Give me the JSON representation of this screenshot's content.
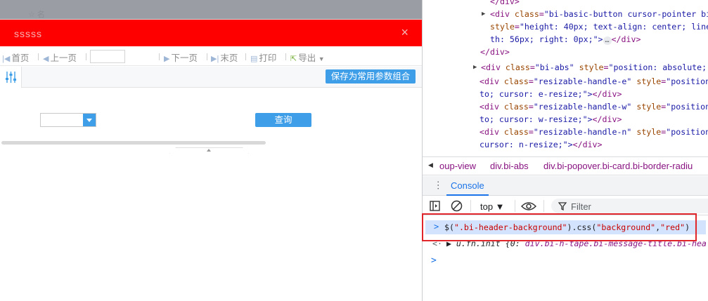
{
  "app": {
    "ghost_text": "☆ 名",
    "dialog": {
      "title": "sssss",
      "close_icon": "×"
    },
    "toolbar": {
      "first": "首页",
      "prev": "上一页",
      "page_value": "",
      "next": "下一页",
      "last": "末页",
      "print": "打印",
      "export": "导出"
    },
    "param": {
      "save_label": "保存为常用参数组合"
    },
    "form": {
      "combo_value": "",
      "query_label": "查询"
    }
  },
  "devtools": {
    "elements": [
      {
        "text": "</div>"
      },
      {
        "open": "<div",
        "attr": "class",
        "val": "\"bi-basic-button cursor-pointer bi",
        "rest": ""
      },
      {
        "attr": "style",
        "val": "\"height: 40px; text-align: center; line"
      },
      {
        "cont": "th: 56px; right: 0px;\">",
        "ellipsis": "…",
        "close": "</div>"
      },
      {
        "text": "</div>"
      },
      {
        "open": "<div",
        "attr": "class",
        "val": "\"bi-abs\"",
        "attr2": "style",
        "val2": "\"position: absolute;"
      },
      {
        "open": "<div",
        "attr": "class",
        "val": "\"resizable-handle-e\"",
        "attr2": "style",
        "val2": "\"position"
      },
      {
        "cont": "to; cursor: e-resize;\">",
        "close": "</div>"
      },
      {
        "open": "<div",
        "attr": "class",
        "val": "\"resizable-handle-w\"",
        "attr2": "style",
        "val2": "\"position"
      },
      {
        "cont": "to; cursor: w-resize;\">",
        "close": "</div>"
      },
      {
        "open": "<div",
        "attr": "class",
        "val": "\"resizable-handle-n\"",
        "attr2": "style",
        "val2": "\"position"
      },
      {
        "cont": "cursor: n-resize;\">",
        "close": "</div>"
      }
    ],
    "breadcrumbs": [
      "oup-view",
      "div.bi-abs",
      "div.bi-popover.bi-card.bi-border-radiu"
    ],
    "drawer_tab": "Console",
    "context": "top ▼",
    "filter_placeholder": "Filter",
    "command": {
      "part1": "$(",
      "s1": "\".bi-header-background\"",
      "part2": ").css(",
      "s2": "\"background\"",
      "part3": ",",
      "s3": "\"red\"",
      "part4": ")"
    },
    "result": {
      "arrow": "<·",
      "prefix": "▶ u.fn.init  {0: ",
      "obj": "div.bi-h-tape.bi-message-title.bi-hea"
    }
  }
}
